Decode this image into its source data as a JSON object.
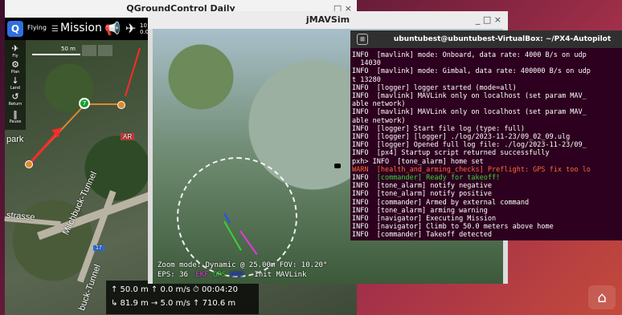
{
  "qgc": {
    "window_title": "QGroundControl Daily",
    "window_controls": "_  □  ×",
    "logo_glyph": "Q",
    "flight_mode": "Flying",
    "plan_mode": "Mission",
    "mission_glyph": "☰",
    "small_values": [
      "10",
      "0.0"
    ],
    "tools": [
      {
        "glyph": "✈",
        "label": "Fly"
      },
      {
        "glyph": "⚙",
        "label": "Plan"
      },
      {
        "glyph": "↓",
        "label": "Land"
      },
      {
        "glyph": "↺",
        "label": "Return"
      },
      {
        "glyph": "‖",
        "label": "Pause"
      }
    ],
    "scale_label": "50 m",
    "vehicle_label": "7",
    "map_labels": {
      "park": "park",
      "strasse": "strasse",
      "tunnel": "Milchbuck-Tunnel",
      "tunnel2": "buck-Tunnel",
      "ar": "AR",
      "seventeen": "17"
    },
    "telemetry": {
      "row1": "↑ 50.0 m  ↑ 0.0 m/s  ⏱ 00:04:20",
      "row2": "↳ 81.9 m  → 5.0 m/s  ↑ 710.6 m"
    }
  },
  "jmavsim": {
    "window_title": "jMAVSim",
    "window_controls": "_  □  ×",
    "hud_line1": "Zoom mode: Dynamic @ 25.00m     FOV: 10.20°",
    "hud_eps": "EPS: 36",
    "hud_ekf": "EKF",
    "hud_gps": "GPS",
    "hud_wind": "WND",
    "hud_extra": "Init MAVLink"
  },
  "terminal": {
    "title": "ubuntubest@ubuntubest-VirtualBox: ~/PX4-Autopilot",
    "icon_glyph": "⊞",
    "lines": [
      {
        "level": "INFO",
        "module": "  [mavlink] mode: Onboard, data rate: 4000 B/s on udp",
        "style": "white"
      },
      {
        "level": "",
        "module": "  14030",
        "style": "white"
      },
      {
        "level": "INFO",
        "module": "  [mavlink] mode: Gimbal, data rate: 400000 B/s on udp",
        "style": "white"
      },
      {
        "level": "",
        "module": "t 13280",
        "style": "white"
      },
      {
        "level": "INFO",
        "module": "  [logger] logger started (mode=all)",
        "style": "white"
      },
      {
        "level": "INFO",
        "module": "  [mavlink] MAVLink only on localhost (set param MAV_",
        "style": "white"
      },
      {
        "level": "",
        "module": "able network)",
        "style": "white"
      },
      {
        "level": "INFO",
        "module": "  [mavlink] MAVLink only on localhost (set param MAV_",
        "style": "white"
      },
      {
        "level": "",
        "module": "able network)",
        "style": "white"
      },
      {
        "level": "INFO",
        "module": "  [logger] Start file log (type: full)",
        "style": "white"
      },
      {
        "level": "INFO",
        "module": "  [logger] [logger] ./log/2023-11-23/09_02_09.ulg",
        "style": "white"
      },
      {
        "level": "INFO",
        "module": "  [logger] Opened full log file: ./log/2023-11-23/09_",
        "style": "white"
      },
      {
        "level": "INFO",
        "module": "  [px4] Startup script returned successfully",
        "style": "white"
      },
      {
        "level": "pxh>",
        "module": " INFO  [tone_alarm] home set",
        "style": "white"
      },
      {
        "level": "WARN",
        "module": "  [health_and_arming_checks] Preflight: GPS fix too lo",
        "style": "orange"
      },
      {
        "level": "INFO",
        "module": "  [commander] Ready for takeoff!",
        "style": "green"
      },
      {
        "level": "INFO",
        "module": "  [tone_alarm] notify negative",
        "style": "white"
      },
      {
        "level": "INFO",
        "module": "  [tone_alarm] notify positive",
        "style": "white"
      },
      {
        "level": "INFO",
        "module": "  [commander] Armed by external command",
        "style": "white"
      },
      {
        "level": "INFO",
        "module": "  [tone_alarm] arming warning",
        "style": "white"
      },
      {
        "level": "INFO",
        "module": "  [navigator] Executing Mission",
        "style": "white"
      },
      {
        "level": "INFO",
        "module": "  [navigator] Climb to 50.0 meters above home",
        "style": "white"
      },
      {
        "level": "INFO",
        "module": "  [commander] Takeoff detected",
        "style": "white"
      }
    ]
  },
  "dock": {
    "home_glyph": "⌂"
  },
  "colors": {
    "terminal_bg": "#2c001e",
    "warn": "#ff6a3a",
    "ready": "#3ad13a",
    "vehicle": "#1a9e2e",
    "qgc_accent": "#2f6fe0"
  }
}
